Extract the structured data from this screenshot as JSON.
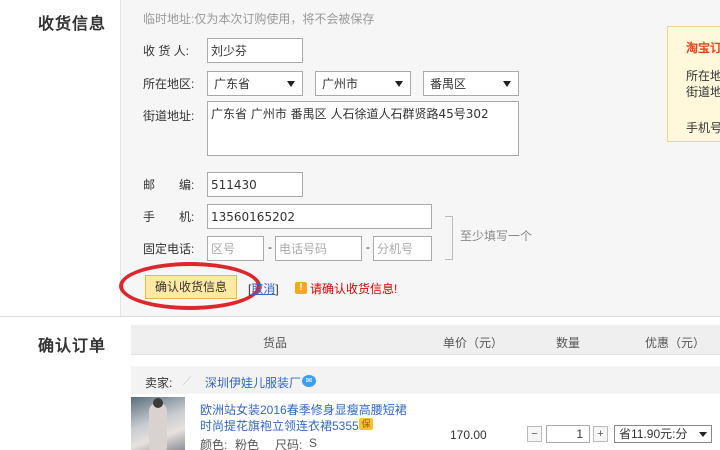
{
  "sections": {
    "address_title": "收货信息",
    "order_title": "确认订单"
  },
  "address_form": {
    "hint": "临时地址:仅为本次订购使用，将不会被保存",
    "receiver_label": "收 货 人:",
    "receiver_value": "刘少芬",
    "region_label": "所在地区:",
    "province": "广东省",
    "city": "广州市",
    "district": "番禺区",
    "street_label": "街道地址:",
    "street_value": "广东省 广州市 番禺区 人石徐道人石群贤路45号302",
    "zip_label": "邮　　编:",
    "zip_value": "511430",
    "mobile_label": "手　　机:",
    "mobile_value": "13560165202",
    "phone_label": "固定电话:",
    "area_code_placeholder": "区号",
    "phone_placeholder": "电话号码",
    "ext_placeholder": "分机号",
    "dash": "-",
    "at_least_one_note": "至少填写一个",
    "confirm_button": "确认收货信息",
    "cancel_prefix": "[",
    "cancel_label": "取消",
    "cancel_suffix": "]",
    "warning_text": "请确认收货信息!"
  },
  "tip_box": {
    "title": "淘宝订",
    "line1": "所在地",
    "line2": "街道地",
    "line3": "手机号"
  },
  "order_table": {
    "headers": {
      "item": "货品",
      "unit_price": "单价（元）",
      "quantity": "数量",
      "discount": "优惠（元）"
    },
    "seller_label": "卖家:",
    "seller_name": "深圳伊娃儿服装厂",
    "item": {
      "title_line1": "欧洲站女装2016春季修身显瘦高腰短裙",
      "title_line2": "时尚提花旗袍立领连衣裙5355",
      "color_label": "颜色:",
      "color_value": "粉色",
      "size_label": "尺码:",
      "size_value": "S",
      "price": "170.00",
      "quantity": "1",
      "minus": "−",
      "plus": "+",
      "discount_option": "省11.90元:分"
    }
  },
  "colors": {
    "accent_red": "#e0262d",
    "link_blue": "#3366cc",
    "button_yellow": "#ffe9a3",
    "warning_red": "#dd0000"
  }
}
